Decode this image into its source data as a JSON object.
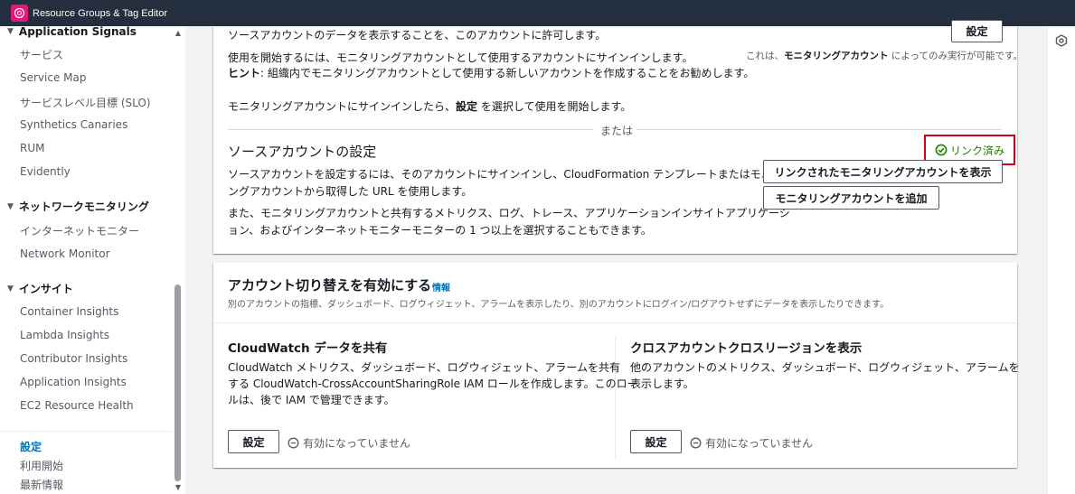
{
  "app": {
    "title": "Resource Groups & Tag Editor"
  },
  "sidebar": {
    "sections": [
      {
        "label": "Application Signals",
        "items": [
          "サービス",
          "Service Map",
          "サービスレベル目標 (SLO)",
          "Synthetics Canaries",
          "RUM",
          "Evidently"
        ]
      },
      {
        "label": "ネットワークモニタリング",
        "items": [
          "インターネットモニター",
          "Network Monitor"
        ]
      },
      {
        "label": "インサイト",
        "items": [
          "Container Insights",
          "Lambda Insights",
          "Contributor Insights",
          "Application Insights",
          "EC2 Resource Health"
        ]
      }
    ],
    "footer": [
      "設定",
      "利用開始",
      "最新情報"
    ]
  },
  "monitoring": {
    "allow_text": "ソースアカウントのデータを表示することを、このアカウントに許可します。",
    "settings_button": "設定",
    "start_text": "使用を開始するには、モニタリングアカウントとして使用するアカウントにサインインします。",
    "hint_label": "ヒント",
    "hint_text": ": 組織内でモニタリングアカウントとして使用する新しいアカウントを作成することをお勧めします。",
    "only_prefix": "これは、",
    "only_bold": "モニタリングアカウント",
    "only_suffix": " によってのみ実行が可能です。",
    "signin_prefix": "モニタリングアカウントにサインインしたら、",
    "signin_bold": "設定",
    "signin_suffix": " を選択して使用を開始します。",
    "or_label": "または"
  },
  "source": {
    "title": "ソースアカウントの設定",
    "linked_label": "リンク済み",
    "desc_line1": "ソースアカウントを設定するには、そのアカウントにサインインし、CloudFormation テンプレートまたはモニタリ",
    "desc_line2": "ングアカウントから取得した URL を使用します。",
    "also_line1": "また、モニタリングアカウントと共有するメトリクス、ログ、トレース、アプリケーションインサイトアプリケーシ",
    "also_line2": "ョン、およびインターネットモニターモニターの 1 つ以上を選択することもできます。",
    "view_button": "リンクされたモニタリングアカウントを表示",
    "add_button": "モニタリングアカウントを追加"
  },
  "cross": {
    "title": "アカウント切り替えを有効にする",
    "info_link": "情報",
    "desc": "別のアカウントの指標、ダッシュボード、ログウィジェット、アラームを表示したり、別のアカウントにログイン/ログアウトせずにデータを表示したりできます。",
    "share": {
      "title": "CloudWatch データを共有",
      "line1": "CloudWatch メトリクス、ダッシュボード、ログウィジェット、アラームを共有",
      "line2": "する CloudWatch-CrossAccountSharingRole IAM ロールを作成します。このロー",
      "line3": "ルは、後で IAM で管理できます。",
      "button": "設定",
      "status": "有効になっていません"
    },
    "view": {
      "title": "クロスアカウントクロスリージョンを表示",
      "line1": "他のアカウントのメトリクス、ダッシュボード、ログウィジェット、アラームを",
      "line2": "表示します。",
      "button": "設定",
      "status": "有効になっていません"
    }
  },
  "colors": {
    "topbar": "#232f3e",
    "link": "#0073bb",
    "success": "#1d8102",
    "highlight": "#d0021b"
  }
}
